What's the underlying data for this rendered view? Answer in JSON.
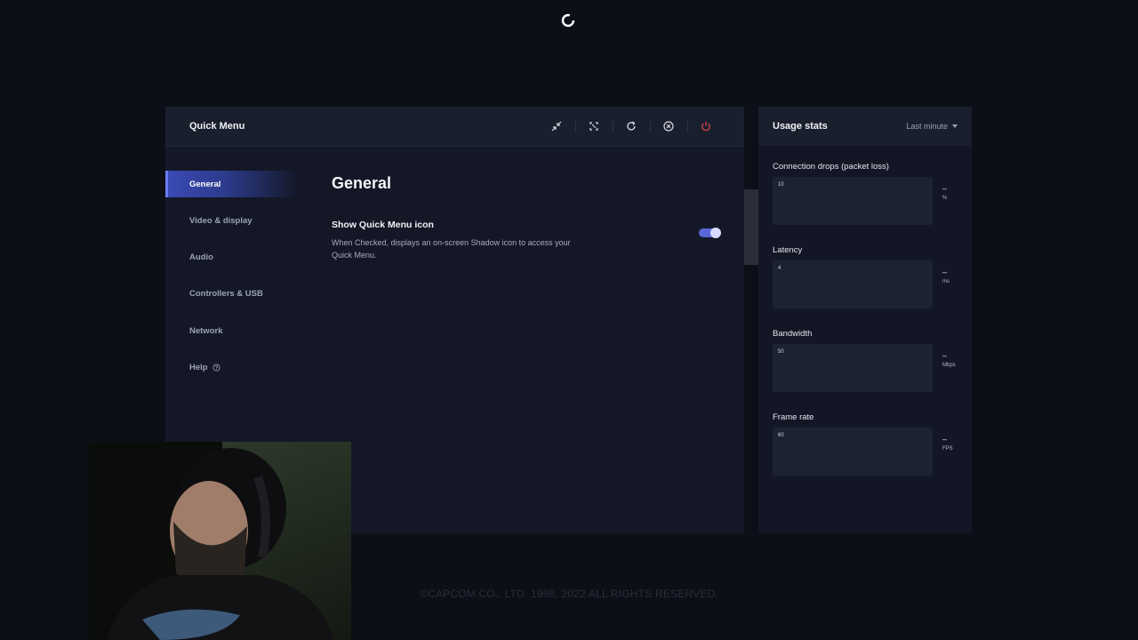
{
  "quick_menu": {
    "title": "Quick Menu",
    "actions": [
      {
        "name": "minimize-icon"
      },
      {
        "name": "resize-icon"
      },
      {
        "name": "refresh-icon"
      },
      {
        "name": "close-circle-icon"
      },
      {
        "name": "power-icon",
        "color": "#e0424e"
      }
    ],
    "sidebar": [
      {
        "label": "General",
        "active": true
      },
      {
        "label": "Video & display"
      },
      {
        "label": "Audio"
      },
      {
        "label": "Controllers & USB"
      },
      {
        "label": "Network"
      },
      {
        "label": "Help",
        "icon": "help-circle-icon"
      }
    ],
    "page_title": "General",
    "settings": [
      {
        "title": "Show Quick Menu icon",
        "description": "When Checked, displays an on-screen Shadow icon to access your Quick Menu.",
        "enabled": true
      }
    ]
  },
  "usage_stats": {
    "title": "Usage stats",
    "range": "Last minute",
    "metrics": [
      {
        "label": "Connection drops (packet loss)",
        "max": "10",
        "value": "–",
        "unit": "%"
      },
      {
        "label": "Latency",
        "max": "4",
        "value": "–",
        "unit": "ms"
      },
      {
        "label": "Bandwidth",
        "max": "50",
        "value": "–",
        "unit": "Mbps"
      },
      {
        "label": "Frame rate",
        "max": "60",
        "value": "–",
        "unit": "FPS"
      }
    ]
  },
  "copyright": "©CAPCOM CO., LTD. 1998, 2022 ALL RIGHTS RESERVED.",
  "colors": {
    "accent": "#5a67d8",
    "power": "#e0424e",
    "panel": "#141826"
  }
}
